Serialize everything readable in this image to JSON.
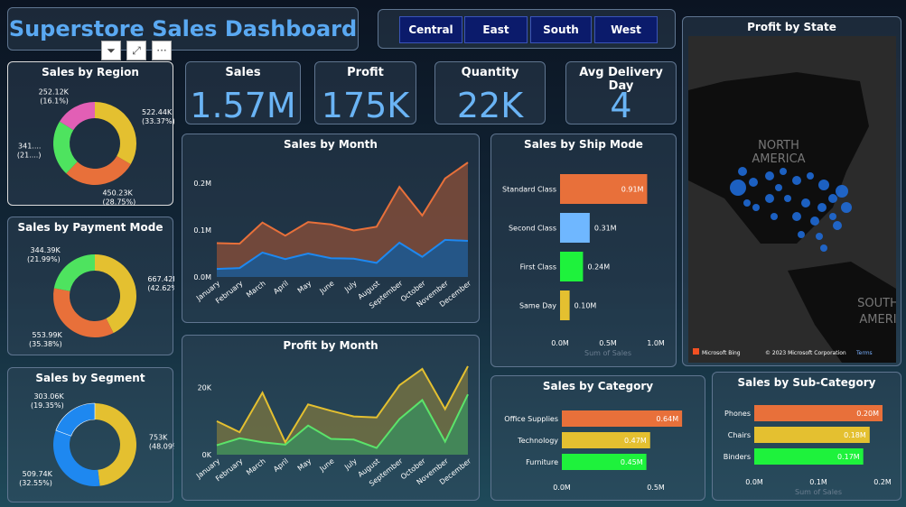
{
  "title": "Superstore Sales Dashboard",
  "filters": [
    "Central",
    "East",
    "South",
    "West"
  ],
  "visual_header": {
    "icons": [
      "filter-icon",
      "focus-mode-icon",
      "more-options-icon"
    ],
    "more_label": "···"
  },
  "kpis": [
    {
      "label": "Sales",
      "value": "1.57M"
    },
    {
      "label": "Profit",
      "value": "175K"
    },
    {
      "label": "Quantity",
      "value": "22K"
    },
    {
      "label": "Avg Delivery Day",
      "value": "4"
    }
  ],
  "map": {
    "title": "Profit by State",
    "labels": [
      "NORTH",
      "AMERICA",
      "SOUTH",
      "AMERI"
    ],
    "attribution": "Microsoft Bing",
    "copyright": "© 2023 Microsoft Corporation",
    "terms": "Terms"
  },
  "colors": {
    "orange": "#e8703a",
    "yellow": "#e4c030",
    "green": "#4ee35f",
    "pink": "#e25fb5",
    "blue": "#1e88f0",
    "lightblue": "#6fb7ff",
    "brightgreen": "#1ef23c",
    "accent": "#5aa9f2"
  },
  "chart_data": [
    {
      "id": "region",
      "type": "pie",
      "title": "Sales by Region",
      "labels": [
        [
          "522.44K",
          "(33.37%)"
        ],
        [
          "450.23K",
          "(28.75%)"
        ],
        [
          "341....",
          "(21....)"
        ],
        [
          "252.12K",
          "(16.1%)"
        ]
      ],
      "values": [
        522.44,
        450.23,
        341,
        252.12
      ],
      "colors": [
        "#e4c030",
        "#e8703a",
        "#4ee35f",
        "#e25fb5"
      ]
    },
    {
      "id": "payment",
      "type": "pie",
      "title": "Sales by Payment Mode",
      "labels": [
        [
          "667.42K",
          "(42.62%)"
        ],
        [
          "553.99K",
          "(35.38%)"
        ],
        [
          "344.39K",
          "(21.99%)"
        ]
      ],
      "values": [
        667.42,
        553.99,
        344.39
      ],
      "colors": [
        "#e4c030",
        "#e8703a",
        "#4ee35f"
      ]
    },
    {
      "id": "segment",
      "type": "pie",
      "title": "Sales by Segment",
      "labels": [
        [
          "753K",
          "(48.09%)"
        ],
        [
          "509.74K",
          "(32.55%)"
        ],
        [
          "303.06K",
          "(19.35%)"
        ]
      ],
      "values": [
        753,
        509.74,
        303.06
      ],
      "colors": [
        "#e4c030",
        "#1e88f0",
        "#1e88f0"
      ]
    },
    {
      "id": "salesmonth",
      "type": "area",
      "title": "Sales by Month",
      "categories": [
        "January",
        "February",
        "March",
        "April",
        "May",
        "June",
        "July",
        "August",
        "September",
        "October",
        "November",
        "December"
      ],
      "yticks": [
        "0.0M",
        "0.1M",
        "0.2M"
      ],
      "ylim": [
        0,
        0.25
      ],
      "series": [
        {
          "values": [
            0.072,
            0.071,
            0.116,
            0.088,
            0.117,
            0.112,
            0.099,
            0.107,
            0.192,
            0.131,
            0.21,
            0.244
          ],
          "color": "#e8703a",
          "fill": "#7a4a3a"
        },
        {
          "values": [
            0.017,
            0.019,
            0.052,
            0.038,
            0.05,
            0.04,
            0.039,
            0.03,
            0.073,
            0.043,
            0.079,
            0.077
          ],
          "color": "#1e88f0",
          "fill": "#1d5890"
        }
      ]
    },
    {
      "id": "profitmonth",
      "type": "area",
      "title": "Profit by Month",
      "categories": [
        "January",
        "February",
        "March",
        "April",
        "May",
        "June",
        "July",
        "August",
        "September",
        "October",
        "November",
        "December"
      ],
      "yticks": [
        "0K",
        "20K"
      ],
      "ylim": [
        0,
        28000
      ],
      "series": [
        {
          "values": [
            10000,
            6700,
            18500,
            3700,
            15000,
            13100,
            11400,
            11100,
            20700,
            25600,
            13600,
            26400
          ],
          "color": "#e4c030",
          "fill": "#6e6e44"
        },
        {
          "values": [
            2800,
            4900,
            3700,
            3000,
            8700,
            4700,
            4500,
            2000,
            10600,
            16300,
            3900,
            18000
          ],
          "color": "#5be36a",
          "fill": "#3f8a5a"
        }
      ]
    },
    {
      "id": "shipmode",
      "type": "bar",
      "title": "Sales by Ship Mode",
      "categories": [
        "Standard Class",
        "Second Class",
        "First Class",
        "Same Day"
      ],
      "values": [
        0.91,
        0.31,
        0.24,
        0.1
      ],
      "labels": [
        "0.91M",
        "0.31M",
        "0.24M",
        "0.10M"
      ],
      "colors": [
        "#e8703a",
        "#6fb7ff",
        "#1ef23c",
        "#e4c030"
      ],
      "xticks": [
        "0.0M",
        "0.5M",
        "1.0M"
      ],
      "xlim": [
        0,
        1.0
      ],
      "xlabel": "Sum of Sales"
    },
    {
      "id": "category",
      "type": "bar",
      "title": "Sales by Category",
      "categories": [
        "Office Supplies",
        "Technology",
        "Furniture"
      ],
      "values": [
        0.64,
        0.47,
        0.45
      ],
      "labels": [
        "0.64M",
        "0.47M",
        "0.45M"
      ],
      "colors": [
        "#e8703a",
        "#e4c030",
        "#1ef23c"
      ],
      "xticks": [
        "0.0M",
        "0.5M"
      ],
      "xlim": [
        0,
        0.5
      ]
    },
    {
      "id": "subcategory",
      "type": "bar",
      "title": "Sales by Sub-Category",
      "categories": [
        "Phones",
        "Chairs",
        "Binders"
      ],
      "values": [
        0.2,
        0.18,
        0.17
      ],
      "labels": [
        "0.20M",
        "0.18M",
        "0.17M"
      ],
      "colors": [
        "#e8703a",
        "#e4c030",
        "#1ef23c"
      ],
      "xticks": [
        "0.0M",
        "0.1M",
        "0.2M"
      ],
      "xlim": [
        0,
        0.2
      ],
      "xlabel": "Sum of Sales"
    }
  ]
}
